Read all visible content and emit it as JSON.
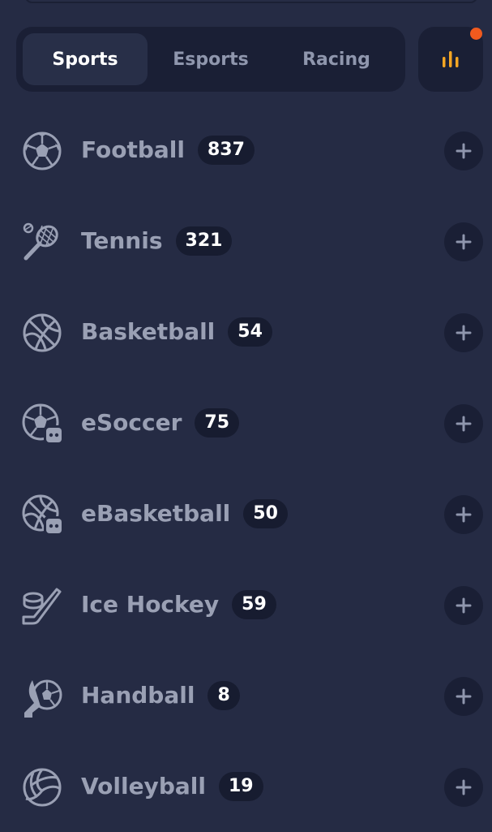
{
  "tabs": [
    {
      "label": "Sports",
      "active": true
    },
    {
      "label": "Esports",
      "active": false
    },
    {
      "label": "Racing",
      "active": false
    }
  ],
  "stats_button": {
    "icon": "bar-chart-icon",
    "has_notification": true
  },
  "colors": {
    "background": "#252b44",
    "panel": "#1a1f35",
    "active_tab": "#282f48",
    "label": "#9aa0b4",
    "notification": "#f05a1e",
    "chart_icon": "#f5a623"
  },
  "sports": [
    {
      "name": "Football",
      "count": "837",
      "icon": "football-icon"
    },
    {
      "name": "Tennis",
      "count": "321",
      "icon": "tennis-icon"
    },
    {
      "name": "Basketball",
      "count": "54",
      "icon": "basketball-icon"
    },
    {
      "name": "eSoccer",
      "count": "75",
      "icon": "esoccer-icon"
    },
    {
      "name": "eBasketball",
      "count": "50",
      "icon": "ebasketball-icon"
    },
    {
      "name": "Ice Hockey",
      "count": "59",
      "icon": "ice-hockey-icon"
    },
    {
      "name": "Handball",
      "count": "8",
      "icon": "handball-icon"
    },
    {
      "name": "Volleyball",
      "count": "19",
      "icon": "volleyball-icon"
    }
  ]
}
